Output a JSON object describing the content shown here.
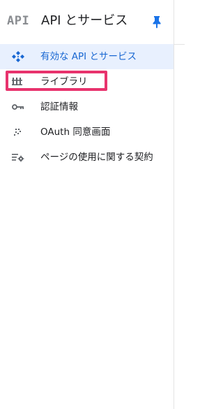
{
  "header": {
    "logo_text": "API",
    "title": "API とサービス",
    "pin_icon": "pin-icon"
  },
  "nav": {
    "items": [
      {
        "label": "有効な API とサービス",
        "icon": "api-diamond-icon",
        "active": true
      },
      {
        "label": "ライブラリ",
        "icon": "library-icon",
        "active": false,
        "highlighted": true
      },
      {
        "label": "認証情報",
        "icon": "key-icon",
        "active": false
      },
      {
        "label": "OAuth 同意画面",
        "icon": "oauth-dots-icon",
        "active": false
      },
      {
        "label": "ページの使用に関する契約",
        "icon": "settings-list-icon",
        "active": false
      }
    ]
  },
  "colors": {
    "active_bg": "#e8f0fe",
    "active_text": "#1967d2",
    "highlight_border": "#e8336d",
    "pin": "#1a73e8"
  }
}
